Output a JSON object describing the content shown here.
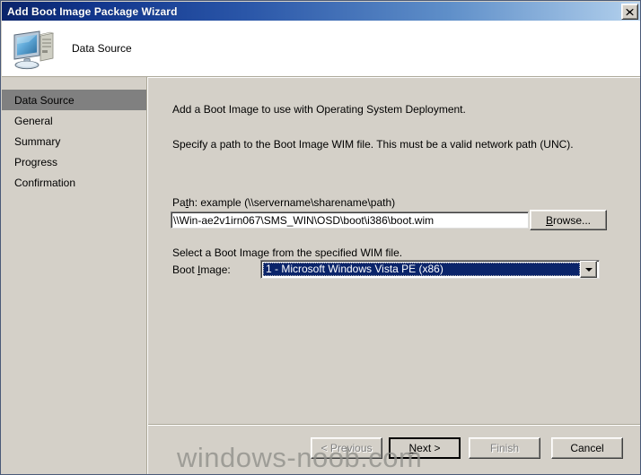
{
  "window": {
    "title": "Add Boot Image Package Wizard",
    "close_label": "✕"
  },
  "header": {
    "icon": "computer-icon",
    "title": "Data Source"
  },
  "sidebar": {
    "items": [
      {
        "label": "Data Source",
        "active": true
      },
      {
        "label": "General",
        "active": false
      },
      {
        "label": "Summary",
        "active": false
      },
      {
        "label": "Progress",
        "active": false
      },
      {
        "label": "Confirmation",
        "active": false
      }
    ]
  },
  "main": {
    "intro": "Add a Boot Image to use with Operating System Deployment.",
    "specify": "Specify a path to the Boot Image WIM file. This must be a valid network path (UNC).",
    "path_label_pre": "Pa",
    "path_label_accel": "t",
    "path_label_post": "h: example (\\\\servername\\sharename\\path)",
    "path_value": "\\\\Win-ae2v1irn067\\SMS_WIN\\OSD\\boot\\i386\\boot.wim",
    "path_placeholder": "\\\\servername\\sharename\\path",
    "browse_label": "Browse...",
    "browse_accel": "B",
    "select_line": "Select a Boot Image from the specified WIM file.",
    "bootimg_label_pre": "Boot ",
    "bootimg_label_accel": "I",
    "bootimg_label_post": "mage:",
    "bootimg_value": "1 - Microsoft Windows Vista PE (x86)",
    "bootimg_options": [
      "1 - Microsoft Windows Vista PE (x86)"
    ]
  },
  "footer": {
    "previous_label": "< Previous",
    "previous_accel": "P",
    "next_label": "Next >",
    "next_accel": "N",
    "finish_label": "Finish",
    "finish_accel": "F",
    "cancel_label": "Cancel"
  },
  "watermark": {
    "text": "windows-noob.com"
  },
  "colors": {
    "titlebar_start": "#0a246a",
    "titlebar_end": "#bcd6ef",
    "face": "#d4d0c8",
    "selection": "#0a246a",
    "annotation_red": "#e01b1b",
    "sidebar_active": "#808080"
  }
}
